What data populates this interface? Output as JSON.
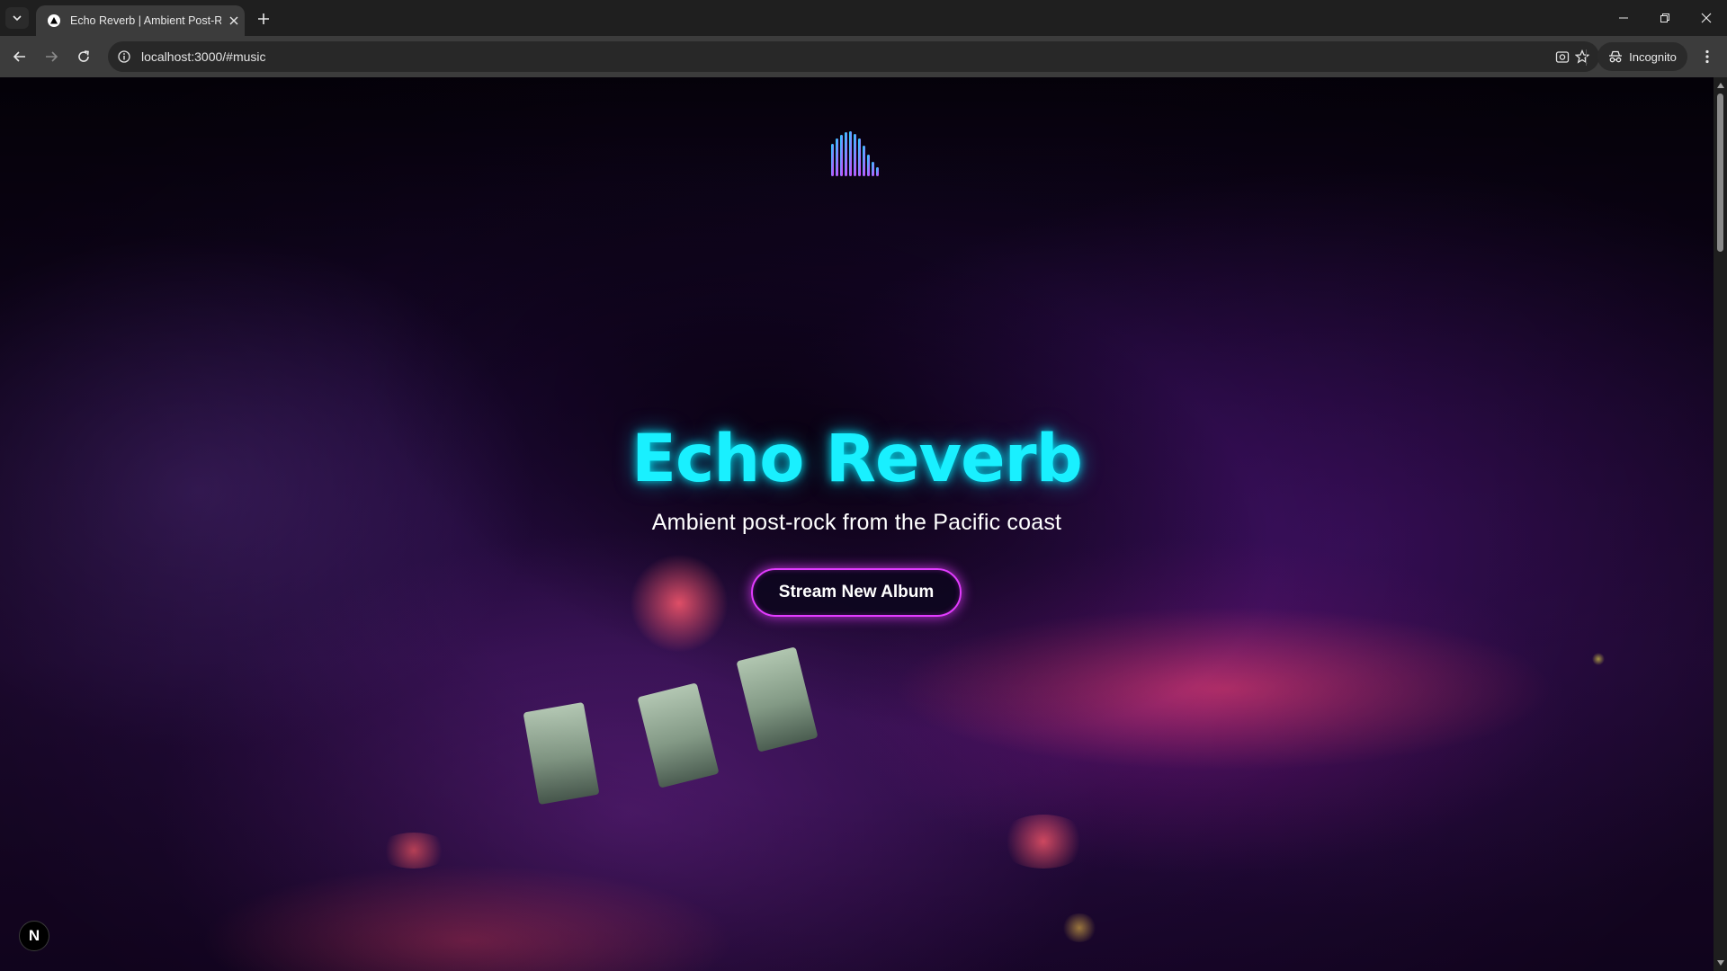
{
  "browser": {
    "tab": {
      "title": "Echo Reverb | Ambient Post-Rock",
      "favicon": "triangle-logo-icon"
    },
    "url": "localhost:3000/#music",
    "profile_label": "Incognito"
  },
  "page": {
    "logo_icon": "equalizer-bars-logo-icon",
    "hero_title": "Echo Reverb",
    "hero_subtitle": "Ambient post-rock from the Pacific coast",
    "cta_label": "Stream New Album",
    "badge_letter": "N"
  },
  "colors": {
    "title_cyan": "#19f0ff",
    "cta_border_magenta": "#e23cff",
    "logo_gradient_start": "#19d8ff",
    "logo_gradient_end": "#e23cff"
  }
}
